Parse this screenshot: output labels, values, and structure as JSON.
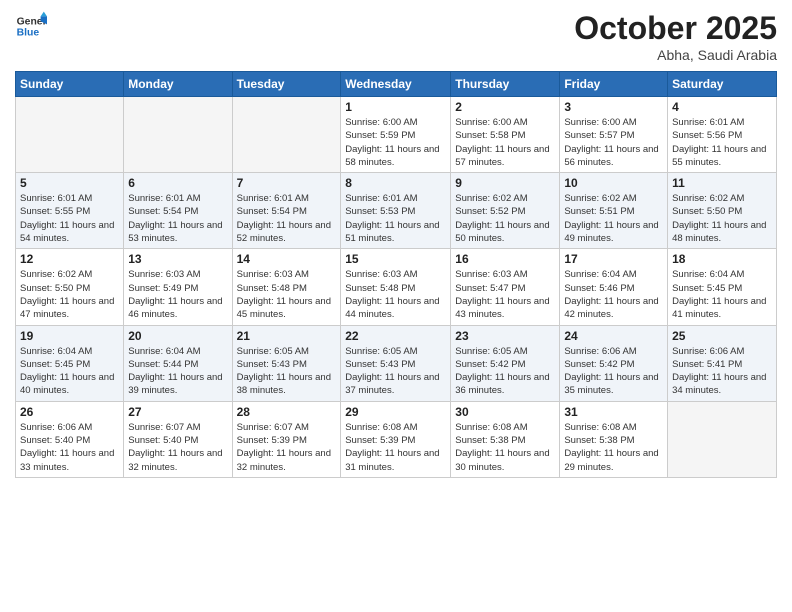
{
  "header": {
    "logo_general": "General",
    "logo_blue": "Blue",
    "month_year": "October 2025",
    "location": "Abha, Saudi Arabia"
  },
  "days_of_week": [
    "Sunday",
    "Monday",
    "Tuesday",
    "Wednesday",
    "Thursday",
    "Friday",
    "Saturday"
  ],
  "weeks": [
    [
      {
        "day": "",
        "empty": true
      },
      {
        "day": "",
        "empty": true
      },
      {
        "day": "",
        "empty": true
      },
      {
        "day": "1",
        "sunrise": "Sunrise: 6:00 AM",
        "sunset": "Sunset: 5:59 PM",
        "daylight": "Daylight: 11 hours and 58 minutes."
      },
      {
        "day": "2",
        "sunrise": "Sunrise: 6:00 AM",
        "sunset": "Sunset: 5:58 PM",
        "daylight": "Daylight: 11 hours and 57 minutes."
      },
      {
        "day": "3",
        "sunrise": "Sunrise: 6:00 AM",
        "sunset": "Sunset: 5:57 PM",
        "daylight": "Daylight: 11 hours and 56 minutes."
      },
      {
        "day": "4",
        "sunrise": "Sunrise: 6:01 AM",
        "sunset": "Sunset: 5:56 PM",
        "daylight": "Daylight: 11 hours and 55 minutes."
      }
    ],
    [
      {
        "day": "5",
        "sunrise": "Sunrise: 6:01 AM",
        "sunset": "Sunset: 5:55 PM",
        "daylight": "Daylight: 11 hours and 54 minutes."
      },
      {
        "day": "6",
        "sunrise": "Sunrise: 6:01 AM",
        "sunset": "Sunset: 5:54 PM",
        "daylight": "Daylight: 11 hours and 53 minutes."
      },
      {
        "day": "7",
        "sunrise": "Sunrise: 6:01 AM",
        "sunset": "Sunset: 5:54 PM",
        "daylight": "Daylight: 11 hours and 52 minutes."
      },
      {
        "day": "8",
        "sunrise": "Sunrise: 6:01 AM",
        "sunset": "Sunset: 5:53 PM",
        "daylight": "Daylight: 11 hours and 51 minutes."
      },
      {
        "day": "9",
        "sunrise": "Sunrise: 6:02 AM",
        "sunset": "Sunset: 5:52 PM",
        "daylight": "Daylight: 11 hours and 50 minutes."
      },
      {
        "day": "10",
        "sunrise": "Sunrise: 6:02 AM",
        "sunset": "Sunset: 5:51 PM",
        "daylight": "Daylight: 11 hours and 49 minutes."
      },
      {
        "day": "11",
        "sunrise": "Sunrise: 6:02 AM",
        "sunset": "Sunset: 5:50 PM",
        "daylight": "Daylight: 11 hours and 48 minutes."
      }
    ],
    [
      {
        "day": "12",
        "sunrise": "Sunrise: 6:02 AM",
        "sunset": "Sunset: 5:50 PM",
        "daylight": "Daylight: 11 hours and 47 minutes."
      },
      {
        "day": "13",
        "sunrise": "Sunrise: 6:03 AM",
        "sunset": "Sunset: 5:49 PM",
        "daylight": "Daylight: 11 hours and 46 minutes."
      },
      {
        "day": "14",
        "sunrise": "Sunrise: 6:03 AM",
        "sunset": "Sunset: 5:48 PM",
        "daylight": "Daylight: 11 hours and 45 minutes."
      },
      {
        "day": "15",
        "sunrise": "Sunrise: 6:03 AM",
        "sunset": "Sunset: 5:48 PM",
        "daylight": "Daylight: 11 hours and 44 minutes."
      },
      {
        "day": "16",
        "sunrise": "Sunrise: 6:03 AM",
        "sunset": "Sunset: 5:47 PM",
        "daylight": "Daylight: 11 hours and 43 minutes."
      },
      {
        "day": "17",
        "sunrise": "Sunrise: 6:04 AM",
        "sunset": "Sunset: 5:46 PM",
        "daylight": "Daylight: 11 hours and 42 minutes."
      },
      {
        "day": "18",
        "sunrise": "Sunrise: 6:04 AM",
        "sunset": "Sunset: 5:45 PM",
        "daylight": "Daylight: 11 hours and 41 minutes."
      }
    ],
    [
      {
        "day": "19",
        "sunrise": "Sunrise: 6:04 AM",
        "sunset": "Sunset: 5:45 PM",
        "daylight": "Daylight: 11 hours and 40 minutes."
      },
      {
        "day": "20",
        "sunrise": "Sunrise: 6:04 AM",
        "sunset": "Sunset: 5:44 PM",
        "daylight": "Daylight: 11 hours and 39 minutes."
      },
      {
        "day": "21",
        "sunrise": "Sunrise: 6:05 AM",
        "sunset": "Sunset: 5:43 PM",
        "daylight": "Daylight: 11 hours and 38 minutes."
      },
      {
        "day": "22",
        "sunrise": "Sunrise: 6:05 AM",
        "sunset": "Sunset: 5:43 PM",
        "daylight": "Daylight: 11 hours and 37 minutes."
      },
      {
        "day": "23",
        "sunrise": "Sunrise: 6:05 AM",
        "sunset": "Sunset: 5:42 PM",
        "daylight": "Daylight: 11 hours and 36 minutes."
      },
      {
        "day": "24",
        "sunrise": "Sunrise: 6:06 AM",
        "sunset": "Sunset: 5:42 PM",
        "daylight": "Daylight: 11 hours and 35 minutes."
      },
      {
        "day": "25",
        "sunrise": "Sunrise: 6:06 AM",
        "sunset": "Sunset: 5:41 PM",
        "daylight": "Daylight: 11 hours and 34 minutes."
      }
    ],
    [
      {
        "day": "26",
        "sunrise": "Sunrise: 6:06 AM",
        "sunset": "Sunset: 5:40 PM",
        "daylight": "Daylight: 11 hours and 33 minutes."
      },
      {
        "day": "27",
        "sunrise": "Sunrise: 6:07 AM",
        "sunset": "Sunset: 5:40 PM",
        "daylight": "Daylight: 11 hours and 32 minutes."
      },
      {
        "day": "28",
        "sunrise": "Sunrise: 6:07 AM",
        "sunset": "Sunset: 5:39 PM",
        "daylight": "Daylight: 11 hours and 32 minutes."
      },
      {
        "day": "29",
        "sunrise": "Sunrise: 6:08 AM",
        "sunset": "Sunset: 5:39 PM",
        "daylight": "Daylight: 11 hours and 31 minutes."
      },
      {
        "day": "30",
        "sunrise": "Sunrise: 6:08 AM",
        "sunset": "Sunset: 5:38 PM",
        "daylight": "Daylight: 11 hours and 30 minutes."
      },
      {
        "day": "31",
        "sunrise": "Sunrise: 6:08 AM",
        "sunset": "Sunset: 5:38 PM",
        "daylight": "Daylight: 11 hours and 29 minutes."
      },
      {
        "day": "",
        "empty": true
      }
    ]
  ]
}
